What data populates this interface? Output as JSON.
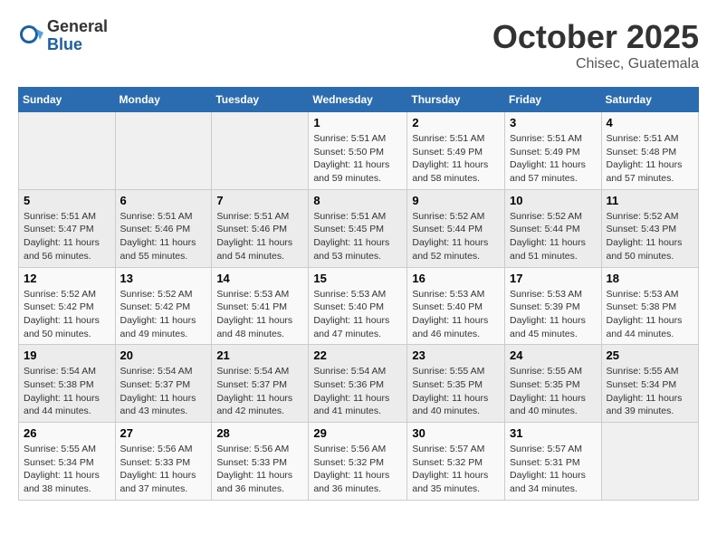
{
  "header": {
    "logo_general": "General",
    "logo_blue": "Blue",
    "month_title": "October 2025",
    "location": "Chisec, Guatemala"
  },
  "days_of_week": [
    "Sunday",
    "Monday",
    "Tuesday",
    "Wednesday",
    "Thursday",
    "Friday",
    "Saturday"
  ],
  "weeks": [
    [
      {
        "day": "",
        "info": ""
      },
      {
        "day": "",
        "info": ""
      },
      {
        "day": "",
        "info": ""
      },
      {
        "day": "1",
        "info": "Sunrise: 5:51 AM\nSunset: 5:50 PM\nDaylight: 11 hours\nand 59 minutes."
      },
      {
        "day": "2",
        "info": "Sunrise: 5:51 AM\nSunset: 5:49 PM\nDaylight: 11 hours\nand 58 minutes."
      },
      {
        "day": "3",
        "info": "Sunrise: 5:51 AM\nSunset: 5:49 PM\nDaylight: 11 hours\nand 57 minutes."
      },
      {
        "day": "4",
        "info": "Sunrise: 5:51 AM\nSunset: 5:48 PM\nDaylight: 11 hours\nand 57 minutes."
      }
    ],
    [
      {
        "day": "5",
        "info": "Sunrise: 5:51 AM\nSunset: 5:47 PM\nDaylight: 11 hours\nand 56 minutes."
      },
      {
        "day": "6",
        "info": "Sunrise: 5:51 AM\nSunset: 5:46 PM\nDaylight: 11 hours\nand 55 minutes."
      },
      {
        "day": "7",
        "info": "Sunrise: 5:51 AM\nSunset: 5:46 PM\nDaylight: 11 hours\nand 54 minutes."
      },
      {
        "day": "8",
        "info": "Sunrise: 5:51 AM\nSunset: 5:45 PM\nDaylight: 11 hours\nand 53 minutes."
      },
      {
        "day": "9",
        "info": "Sunrise: 5:52 AM\nSunset: 5:44 PM\nDaylight: 11 hours\nand 52 minutes."
      },
      {
        "day": "10",
        "info": "Sunrise: 5:52 AM\nSunset: 5:44 PM\nDaylight: 11 hours\nand 51 minutes."
      },
      {
        "day": "11",
        "info": "Sunrise: 5:52 AM\nSunset: 5:43 PM\nDaylight: 11 hours\nand 50 minutes."
      }
    ],
    [
      {
        "day": "12",
        "info": "Sunrise: 5:52 AM\nSunset: 5:42 PM\nDaylight: 11 hours\nand 50 minutes."
      },
      {
        "day": "13",
        "info": "Sunrise: 5:52 AM\nSunset: 5:42 PM\nDaylight: 11 hours\nand 49 minutes."
      },
      {
        "day": "14",
        "info": "Sunrise: 5:53 AM\nSunset: 5:41 PM\nDaylight: 11 hours\nand 48 minutes."
      },
      {
        "day": "15",
        "info": "Sunrise: 5:53 AM\nSunset: 5:40 PM\nDaylight: 11 hours\nand 47 minutes."
      },
      {
        "day": "16",
        "info": "Sunrise: 5:53 AM\nSunset: 5:40 PM\nDaylight: 11 hours\nand 46 minutes."
      },
      {
        "day": "17",
        "info": "Sunrise: 5:53 AM\nSunset: 5:39 PM\nDaylight: 11 hours\nand 45 minutes."
      },
      {
        "day": "18",
        "info": "Sunrise: 5:53 AM\nSunset: 5:38 PM\nDaylight: 11 hours\nand 44 minutes."
      }
    ],
    [
      {
        "day": "19",
        "info": "Sunrise: 5:54 AM\nSunset: 5:38 PM\nDaylight: 11 hours\nand 44 minutes."
      },
      {
        "day": "20",
        "info": "Sunrise: 5:54 AM\nSunset: 5:37 PM\nDaylight: 11 hours\nand 43 minutes."
      },
      {
        "day": "21",
        "info": "Sunrise: 5:54 AM\nSunset: 5:37 PM\nDaylight: 11 hours\nand 42 minutes."
      },
      {
        "day": "22",
        "info": "Sunrise: 5:54 AM\nSunset: 5:36 PM\nDaylight: 11 hours\nand 41 minutes."
      },
      {
        "day": "23",
        "info": "Sunrise: 5:55 AM\nSunset: 5:35 PM\nDaylight: 11 hours\nand 40 minutes."
      },
      {
        "day": "24",
        "info": "Sunrise: 5:55 AM\nSunset: 5:35 PM\nDaylight: 11 hours\nand 40 minutes."
      },
      {
        "day": "25",
        "info": "Sunrise: 5:55 AM\nSunset: 5:34 PM\nDaylight: 11 hours\nand 39 minutes."
      }
    ],
    [
      {
        "day": "26",
        "info": "Sunrise: 5:55 AM\nSunset: 5:34 PM\nDaylight: 11 hours\nand 38 minutes."
      },
      {
        "day": "27",
        "info": "Sunrise: 5:56 AM\nSunset: 5:33 PM\nDaylight: 11 hours\nand 37 minutes."
      },
      {
        "day": "28",
        "info": "Sunrise: 5:56 AM\nSunset: 5:33 PM\nDaylight: 11 hours\nand 36 minutes."
      },
      {
        "day": "29",
        "info": "Sunrise: 5:56 AM\nSunset: 5:32 PM\nDaylight: 11 hours\nand 36 minutes."
      },
      {
        "day": "30",
        "info": "Sunrise: 5:57 AM\nSunset: 5:32 PM\nDaylight: 11 hours\nand 35 minutes."
      },
      {
        "day": "31",
        "info": "Sunrise: 5:57 AM\nSunset: 5:31 PM\nDaylight: 11 hours\nand 34 minutes."
      },
      {
        "day": "",
        "info": ""
      }
    ]
  ]
}
